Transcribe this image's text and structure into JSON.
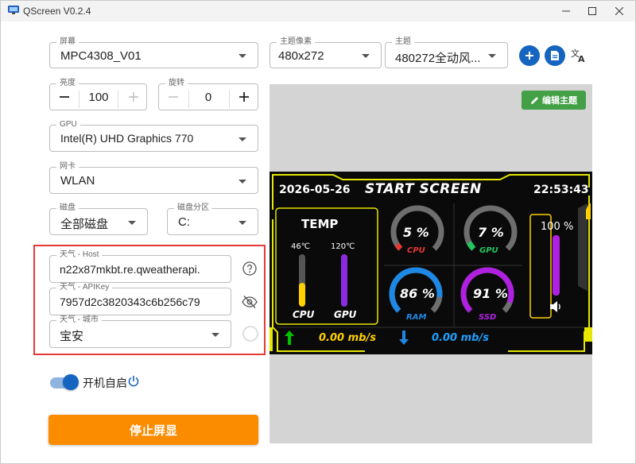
{
  "window": {
    "title": "QScreen V0.2.4"
  },
  "screen_select": {
    "label": "屏幕",
    "value": "MPC4308_V01"
  },
  "theme_resolution": {
    "label": "主题像素",
    "value": "480x272"
  },
  "theme_select": {
    "label": "主题",
    "value": "480272全动风..."
  },
  "brightness": {
    "label": "亮度",
    "value": "100"
  },
  "rotation": {
    "label": "旋转",
    "value": "0"
  },
  "gpu_select": {
    "label": "GPU",
    "value": "Intel(R) UHD Graphics 770"
  },
  "nic_select": {
    "label": "网卡",
    "value": "WLAN"
  },
  "disk_select": {
    "label": "磁盘",
    "value": "全部磁盘"
  },
  "partition_select": {
    "label": "磁盘分区",
    "value": "C:"
  },
  "weather": {
    "host_label": "天气 - Host",
    "host_value": "n22x87mkbt.re.qweatherapi.",
    "apikey_label": "天气 - APIKey",
    "apikey_value": "7957d2c3820343c6b256c79",
    "city_label": "天气 - 城市",
    "city_value": "宝安"
  },
  "autostart": {
    "label": "开机自启",
    "on": true
  },
  "stop_button": {
    "label": "停止屏显"
  },
  "edit_theme_button": {
    "label": "编辑主题"
  },
  "preview": {
    "date": "2026-05-26",
    "brand": "START SCREEN",
    "time": "22:53:43",
    "temp_title": "TEMP",
    "cpu_temp": "46℃",
    "gpu_temp": "120℃",
    "cpu_bar_label": "CPU",
    "gpu_bar_label": "GPU",
    "cpu_temp_fill": 0.45,
    "gpu_temp_fill": 1.0,
    "cpu_pct": "5 %",
    "gpu_pct": "7 %",
    "ram_pct": "86 %",
    "ssd_pct": "91 %",
    "cpu_gauge_label": "CPU",
    "gpu_gauge_label": "GPU",
    "ram_gauge_label": "RAM",
    "ssd_gauge_label": "SSD",
    "cpu_usage": 0.05,
    "gpu_usage": 0.07,
    "ram_usage": 0.86,
    "ssd_usage": 0.91,
    "volume": "100 %",
    "volume_fill": 1.0,
    "upload": "0.00 mb/s",
    "download": "0.00 mb/s",
    "colors": {
      "frame": "#e6e600",
      "cpu": "#e53935",
      "gpu": "#22c55e",
      "ram": "#1e88e5",
      "ssd": "#b020e0",
      "accent": "#ffd000",
      "net": "#00c400"
    }
  },
  "colors": {
    "primary": "#1565c0",
    "highlight_border": "#e53935",
    "stop_button": "#fb8c00",
    "edit_button": "#43a047"
  },
  "icons": [
    "app-icon",
    "minimize-icon",
    "maximize-icon",
    "close-icon",
    "add-icon",
    "document-icon",
    "translate-icon",
    "help-icon",
    "visibility-off-icon",
    "loading-icon",
    "power-icon",
    "pencil-icon"
  ]
}
